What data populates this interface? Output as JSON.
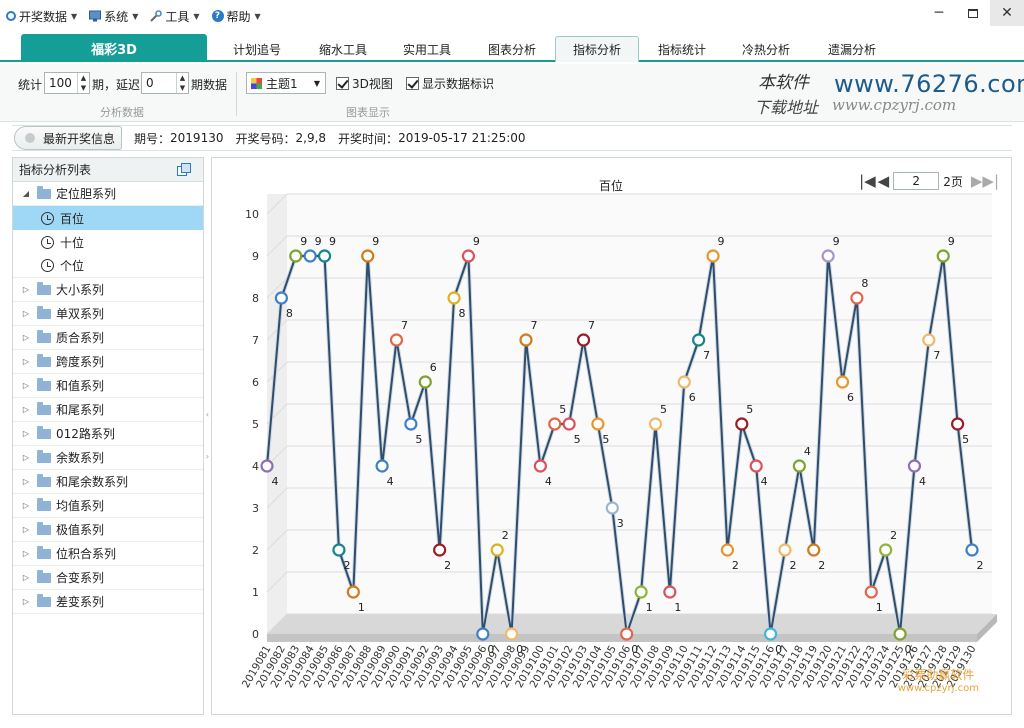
{
  "menubar": {
    "items": [
      {
        "label": "开奖数据"
      },
      {
        "label": "系统"
      },
      {
        "label": "工具"
      },
      {
        "label": "帮助"
      }
    ]
  },
  "tabs": {
    "brand": "福彩3D",
    "items": [
      "计划追号",
      "缩水工具",
      "实用工具",
      "图表分析",
      "指标分析",
      "指标统计",
      "冷热分析",
      "遗漏分析"
    ],
    "active": "指标分析"
  },
  "toolbar": {
    "stat_label": "统计",
    "stat_value": "100",
    "period_delay_label": "期，延迟",
    "delay_value": "0",
    "period_data_label": "期数据",
    "group1_label": "分析数据",
    "theme_value": "主题1",
    "view3d_label": "3D视图",
    "show_labels_label": "显示数据标识",
    "group2_label": "图表显示"
  },
  "logo": {
    "text1": "本软件",
    "text2": "下载地址",
    "url_main": "www.76276.com",
    "url_sub": "www.cpzyrj.com"
  },
  "infobar": {
    "button_label": "最新开奖信息",
    "issue_label": "期号：",
    "issue_value": "2019130",
    "number_label": "开奖号码：",
    "number_value": "2,9,8",
    "time_label": "开奖时间：",
    "time_value": "2019-05-17 21:25:00"
  },
  "leftpanel": {
    "title": "指标分析列表",
    "group_open": "定位胆系列",
    "children": [
      "百位",
      "十位",
      "个位"
    ],
    "selected": "百位",
    "groups": [
      "大小系列",
      "单双系列",
      "质合系列",
      "跨度系列",
      "和值系列",
      "和尾系列",
      "012路系列",
      "余数系列",
      "和尾余数系列",
      "均值系列",
      "极值系列",
      "位积合系列",
      "合变系列",
      "差变系列"
    ]
  },
  "pager": {
    "page_value": "2",
    "total_label": "2页"
  },
  "watermark": {
    "line1": "彩票助赢软件",
    "line2": "www.cpzyrj.com"
  },
  "chart_data": {
    "type": "line",
    "title": "百位",
    "xlabel": "",
    "ylabel": "",
    "ylim": [
      0,
      10
    ],
    "yticks": [
      0,
      1,
      2,
      3,
      4,
      5,
      6,
      7,
      8,
      9,
      10
    ],
    "grid": true,
    "x": [
      "2019081",
      "2019082",
      "2019083",
      "2019084",
      "2019085",
      "2019086",
      "2019087",
      "2019088",
      "2019089",
      "2019090",
      "2019091",
      "2019092",
      "2019093",
      "2019094",
      "2019095",
      "2019096",
      "2019097",
      "2019098",
      "2019099",
      "2019100",
      "2019101",
      "2019102",
      "2019103",
      "2019104",
      "2019105",
      "2019106",
      "2019107",
      "2019108",
      "2019109",
      "2019110",
      "2019111",
      "2019112",
      "2019113",
      "2019114",
      "2019115",
      "2019116",
      "2019117",
      "2019118",
      "2019119",
      "2019120",
      "2019121",
      "2019122",
      "2019123",
      "2019124",
      "2019125",
      "2019126",
      "2019127",
      "2019128",
      "2019129",
      "2019130"
    ],
    "values": [
      4,
      8,
      9,
      9,
      9,
      2,
      1,
      9,
      4,
      7,
      5,
      6,
      2,
      8,
      9,
      0,
      2,
      0,
      7,
      4,
      5,
      5,
      7,
      5,
      3,
      0,
      1,
      5,
      1,
      6,
      7,
      9,
      2,
      5,
      4,
      0,
      2,
      4,
      2,
      9,
      6,
      8,
      1,
      2,
      0,
      4,
      7,
      9,
      5,
      2
    ],
    "line_color": "#2f4e6e",
    "marker_colors": [
      "#3f7fc9",
      "#e8962b",
      "#d9535e",
      "#8fb43a",
      "#8d6fb4",
      "#45b2d8",
      "#9bb8d0",
      "#15858a",
      "#7fa22f",
      "#e0b11e",
      "#e0664c",
      "#9b1d27",
      "#a996c8",
      "#d37a1a",
      "#f0b86b"
    ]
  }
}
